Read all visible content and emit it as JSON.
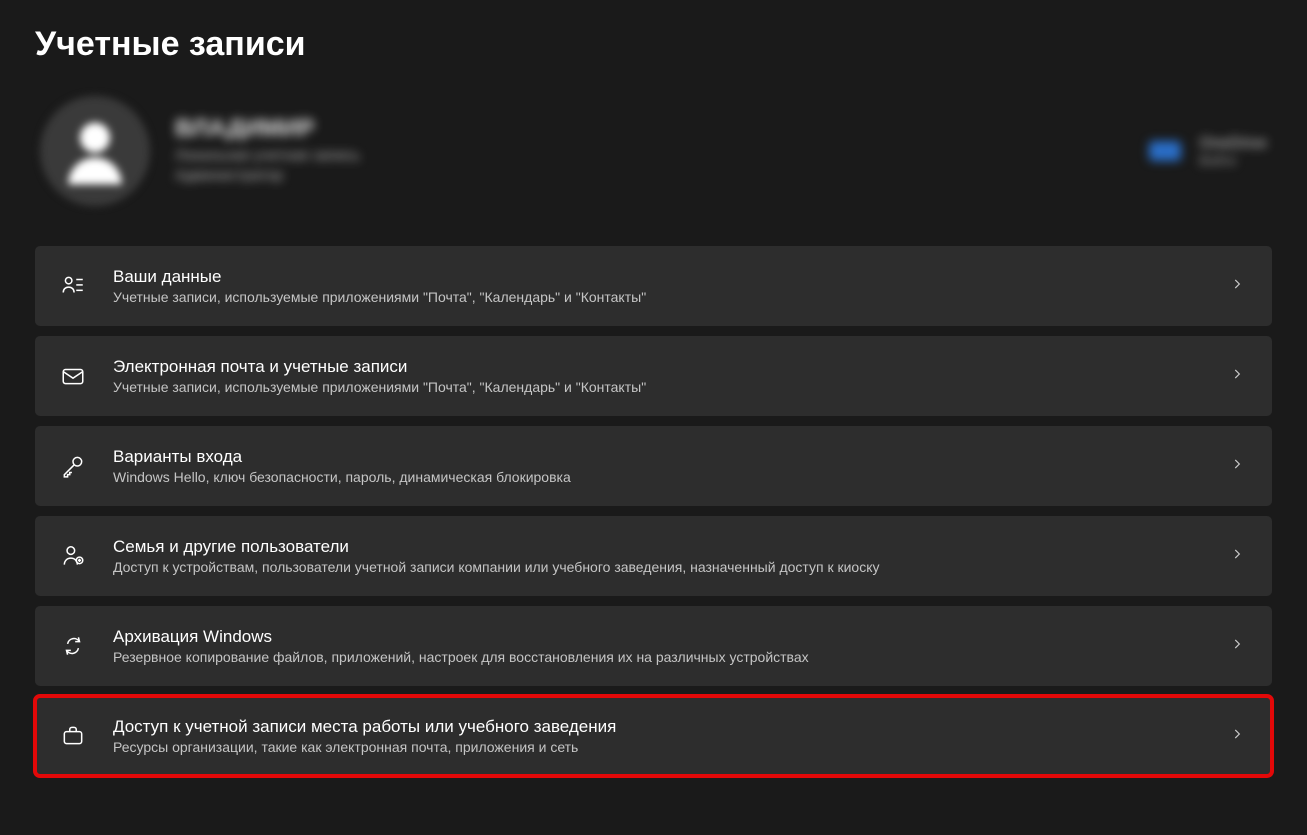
{
  "pageTitle": "Учетные записи",
  "profile": {
    "name": "ВЛАДИМИР",
    "subtitle1": "Локальная учетная запись",
    "subtitle2": "Администратор"
  },
  "cloud": {
    "title": "OneDrive",
    "status": "Войти"
  },
  "items": [
    {
      "id": "your-info",
      "title": "Ваши данные",
      "desc": "Учетные записи, используемые приложениями \"Почта\", \"Календарь\" и \"Контакты\""
    },
    {
      "id": "email-accounts",
      "title": "Электронная почта и учетные записи",
      "desc": "Учетные записи, используемые приложениями \"Почта\", \"Календарь\" и \"Контакты\""
    },
    {
      "id": "signin-options",
      "title": "Варианты входа",
      "desc": "Windows Hello, ключ безопасности, пароль, динамическая блокировка"
    },
    {
      "id": "family-users",
      "title": "Семья и другие пользователи",
      "desc": "Доступ к устройствам, пользователи учетной записи компании или учебного заведения, назначенный доступ к киоску"
    },
    {
      "id": "windows-backup",
      "title": "Архивация Windows",
      "desc": "Резервное копирование файлов, приложений, настроек для восстановления их на различных устройствах"
    },
    {
      "id": "work-school",
      "title": "Доступ к учетной записи места работы или учебного заведения",
      "desc": "Ресурсы организации, такие как электронная почта, приложения и сеть"
    }
  ]
}
